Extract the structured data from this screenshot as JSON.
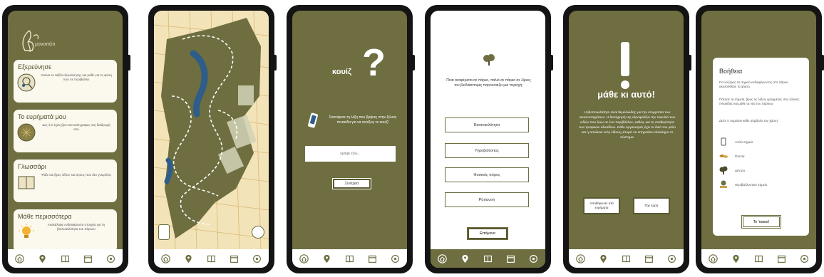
{
  "colors": {
    "olive": "#6e6e41",
    "cream": "#fbf8ee",
    "map_bg": "#f3e3b8",
    "water": "#2e5d8a",
    "frame": "#141414"
  },
  "nav_icons": [
    "home-icon",
    "map-pin-icon",
    "book-icon",
    "calendar-icon",
    "settings-icon"
  ],
  "screen1": {
    "logo_text": "μονοπάτι",
    "cards": [
      {
        "title": "Εξερεύνησε",
        "desc": "Ξεκίνα το ταξίδι εξερεύνησης και μάθε για τη φύση που σε περιβάλλει",
        "icon": "explore-icon"
      },
      {
        "title": "Το ευρήματά μου",
        "desc": "Δες ό,τι έχεις βρει και κατέγραψες στη διαδρομή σου",
        "icon": "findings-icon"
      },
      {
        "title": "Γλωσσάρι",
        "desc": "Ψάξε και βρες λέξεις και όρους που δεν γνωρίζεις",
        "icon": "book-icon"
      },
      {
        "title": "Μάθε περισσότερα",
        "desc": "Ανακάλυψε ενδιαφέροντα στοιχεία για τη βιοποικιλότητα του πάρκου",
        "icon": "lightbulb-icon"
      }
    ]
  },
  "screen3": {
    "title": "κουίζ",
    "mark": "?",
    "text": "Σκανάρισε τη λέξη που βρήκες στην ξύλινη πινακίδα για να ανοίξεις το κουίζ!",
    "placeholder": "γράψε εδώ...",
    "button": "Συνέχεια"
  },
  "screen4": {
    "question": "Ποια αναφέρεται σε πάρκο, παλιό σε πάρκο σε λίμνες του βιοδιάσπορες παρουσιάζει μια περιοχή;",
    "options": [
      "Βιοποικιλότητα",
      "Υγροβιότοπος",
      "Φυσικός πόρος",
      "Ρύπανση"
    ],
    "button": "Επόμενο"
  },
  "screen5": {
    "title": "μάθε κι αυτό!",
    "text": "Η βιοποικιλότητα είναι θεμελιώδης για την ισορροπία των οικοσυστημάτων. Η διατήρησή της εξασφαλίζει την ποικιλία των ειδών που ζουν σε ένα περιβάλλον, καθώς και τη σταθερότητα των τροφικών αλυσίδων. Κάθε οργανισμός έχει το δικό του ρόλο και η απώλεια ενός είδους μπορεί να επηρεάσει ολόκληρο το σύστημα.",
    "btn_left": "Αποθήκευσε στα ευρήματα",
    "btn_right": "Όχι τώρα"
  },
  "screen6": {
    "title": "Βοήθεια",
    "p1": "Για να βρεις τα σημεία ενδιαφέροντος στο πάρκο ακολούθησε τα χάρτη.",
    "p2": "Πάτησε τα σημεία, βρες τις λέξεις γραμμένες στις ξύλινες πινακίδες και μάθε τα νέα του πάρκου.",
    "p3": "Δείτε τι σημαίνει κάθε σύμβολο του χάρτη:",
    "legend": [
      {
        "label": "Απλό σημείο",
        "icon": "phone-marker-icon"
      },
      {
        "label": "Φυτεία",
        "icon": "plant-icon"
      },
      {
        "label": "Δέντρο",
        "icon": "tree-icon"
      },
      {
        "label": "Περιβαλλοντικό σημείο",
        "icon": "picnic-icon"
      }
    ],
    "button": "Το 'πιασα!"
  }
}
